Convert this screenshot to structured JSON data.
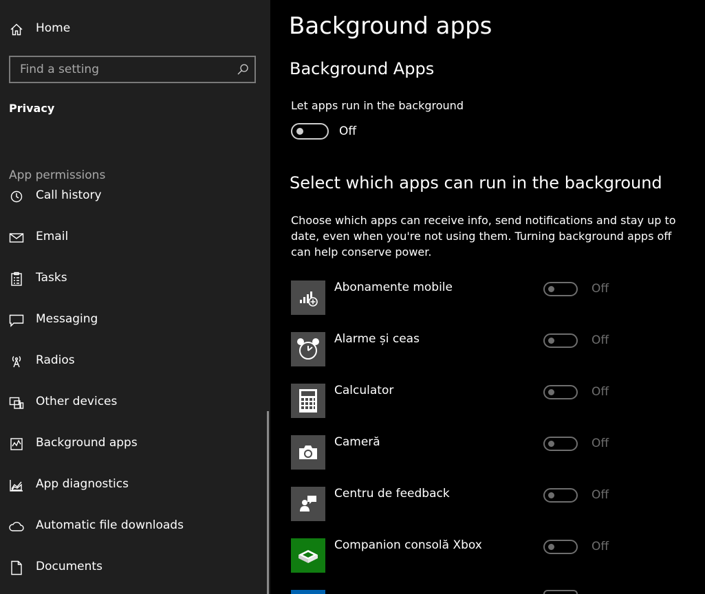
{
  "sidebar": {
    "home": {
      "label": "Home",
      "icon": "home-icon"
    },
    "search": {
      "placeholder": "Find a setting",
      "value": "",
      "icon": "search-icon"
    },
    "section_title": "Privacy",
    "group_title": "App permissions",
    "items": [
      {
        "label": "Call history",
        "icon": "history-icon"
      },
      {
        "label": "Email",
        "icon": "mail-icon"
      },
      {
        "label": "Tasks",
        "icon": "tasks-icon"
      },
      {
        "label": "Messaging",
        "icon": "message-icon"
      },
      {
        "label": "Radios",
        "icon": "radio-icon"
      },
      {
        "label": "Other devices",
        "icon": "devices-icon"
      },
      {
        "label": "Background apps",
        "icon": "background-apps-icon"
      },
      {
        "label": "App diagnostics",
        "icon": "diagnostics-icon"
      },
      {
        "label": "Automatic file downloads",
        "icon": "cloud-icon"
      },
      {
        "label": "Documents",
        "icon": "document-icon"
      }
    ]
  },
  "main": {
    "title": "Background apps",
    "subtitle": "Background Apps",
    "master_toggle": {
      "label": "Let apps run in the background",
      "state": "Off"
    },
    "section_title": "Select which apps can run in the background",
    "description": "Choose which apps can receive info, send notifications and stay up to date, even when you're not using them. Turning background apps off can help conserve power.",
    "apps": [
      {
        "name": "Abonamente mobile",
        "state": "Off",
        "icon": "mobile-signal-icon",
        "tile_color": "#4a4a4a"
      },
      {
        "name": "Alarme și ceas",
        "state": "Off",
        "icon": "alarm-clock-icon",
        "tile_color": "#4a4a4a"
      },
      {
        "name": "Calculator",
        "state": "Off",
        "icon": "calculator-icon",
        "tile_color": "#4a4a4a"
      },
      {
        "name": "Cameră",
        "state": "Off",
        "icon": "camera-icon",
        "tile_color": "#4a4a4a"
      },
      {
        "name": "Centru de feedback",
        "state": "Off",
        "icon": "feedback-icon",
        "tile_color": "#4a4a4a"
      },
      {
        "name": "Companion consolă Xbox",
        "state": "Off",
        "icon": "xbox-console-icon",
        "tile_color": "#107c10"
      }
    ]
  }
}
